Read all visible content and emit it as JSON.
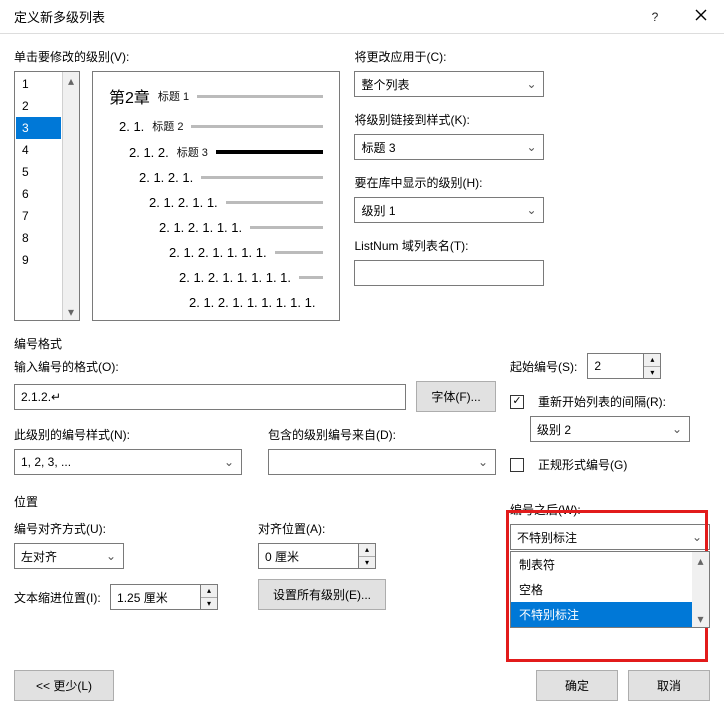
{
  "title": "定义新多级列表",
  "window": {
    "help": "?",
    "close": "×"
  },
  "click_level_label": "单击要修改的级别(V):",
  "levels": [
    "1",
    "2",
    "3",
    "4",
    "5",
    "6",
    "7",
    "8",
    "9"
  ],
  "selected_level_index": 2,
  "preview": [
    {
      "num": "第2章",
      "lbl": "标题 1",
      "cls": "big"
    },
    {
      "num": "2. 1.",
      "lbl": "标题 2",
      "cls": ""
    },
    {
      "num": "2. 1. 2.",
      "lbl": "标题 3",
      "cls": "l3"
    },
    {
      "num": "2. 1. 2. 1.",
      "lbl": "",
      "cls": ""
    },
    {
      "num": "2. 1. 2. 1. 1.",
      "lbl": "",
      "cls": ""
    },
    {
      "num": "2. 1. 2. 1. 1. 1.",
      "lbl": "",
      "cls": ""
    },
    {
      "num": "2. 1. 2. 1. 1. 1. 1.",
      "lbl": "",
      "cls": ""
    },
    {
      "num": "2. 1. 2. 1. 1. 1. 1. 1.",
      "lbl": "",
      "cls": ""
    },
    {
      "num": "2. 1. 2. 1. 1. 1. 1. 1. 1.",
      "lbl": "",
      "cls": ""
    }
  ],
  "right": {
    "apply_label": "将更改应用于(C):",
    "apply_value": "整个列表",
    "link_label": "将级别链接到样式(K):",
    "link_value": "标题 3",
    "gallery_label": "要在库中显示的级别(H):",
    "gallery_value": "级别 1",
    "listnum_label": "ListNum 域列表名(T):",
    "listnum_value": ""
  },
  "numfmt": {
    "section": "编号格式",
    "enter_label": "输入编号的格式(O):",
    "enter_value": "2.1.2.↵",
    "font_btn": "字体(F)...",
    "style_label": "此级别的编号样式(N):",
    "style_value": "1, 2, 3, ...",
    "include_label": "包含的级别编号来自(D):",
    "include_value": ""
  },
  "rhs_num": {
    "start_label": "起始编号(S):",
    "start_value": "2",
    "restart_label": "重新开始列表的间隔(R):",
    "restart_checked": true,
    "restart_level": "级别 2",
    "legal_label": "正规形式编号(G)",
    "legal_checked": false
  },
  "pos": {
    "section": "位置",
    "align_label": "编号对齐方式(U):",
    "align_value": "左对齐",
    "at_label": "对齐位置(A):",
    "at_value": "0 厘米",
    "indent_label": "文本缩进位置(I):",
    "indent_value": "1.25 厘米",
    "setall_btn": "设置所有级别(E)..."
  },
  "follow": {
    "label": "编号之后(W):",
    "value": "不特别标注",
    "options": [
      "制表符",
      "空格",
      "不特别标注"
    ],
    "selected_index": 2
  },
  "footer": {
    "less": "<< 更少(L)",
    "ok": "确定",
    "cancel": "取消"
  }
}
